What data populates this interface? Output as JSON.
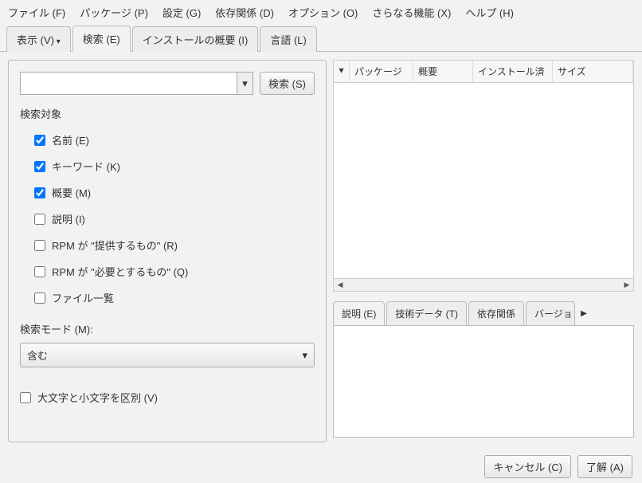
{
  "menubar": {
    "file": "ファイル (F)",
    "package": "パッケージ (P)",
    "settings": "設定 (G)",
    "deps": "依存関係 (D)",
    "options": "オプション (O)",
    "extra": "さらなる機能 (X)",
    "help": "ヘルプ (H)"
  },
  "mainTabs": {
    "view": "表示 (V)",
    "search": "検索 (E)",
    "installSummary": "インストールの概要 (I)",
    "language": "言語 (L)"
  },
  "search": {
    "button": "検索 (S)",
    "targetLabel": "検索対象",
    "checks": {
      "name": "名前 (E)",
      "keyword": "キーワード (K)",
      "summary": "概要 (M)",
      "description": "説明 (I)",
      "provides": "RPM が \"提供するもの\" (R)",
      "requires": "RPM が \"必要とするもの\" (Q)",
      "filelist": "ファイル一覧"
    },
    "modeLabel": "検索モード (M):",
    "modeValue": "含む",
    "caseLabel": "大文字と小文字を区別 (V)"
  },
  "table": {
    "cols": {
      "package": "パッケージ",
      "summary": "概要",
      "installed": "インストール済",
      "size": "サイズ"
    }
  },
  "detailTabs": {
    "description": "説明 (E)",
    "techdata": "技術データ (T)",
    "deps": "依存関係",
    "versions": "バージョン"
  },
  "footer": {
    "cancel": "キャンセル (C)",
    "ok": "了解 (A)"
  }
}
